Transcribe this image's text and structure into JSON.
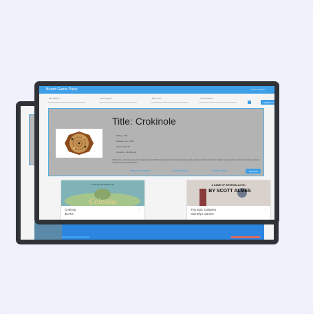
{
  "app": {
    "title": "Board Game Party",
    "user": "Hello Jonathan"
  },
  "filters": {
    "fields": [
      "Min Players",
      "Max Players",
      "Max Time",
      "Name Search"
    ],
    "search_label": "SEARCH",
    "search_icon": "search-icon"
  },
  "detail": {
    "title": "Title: Crokinole",
    "facts": [
      "Rating: 6.95",
      "Release Year: 1876",
      "Value: $144.95",
      "Condition: Unaffected"
    ],
    "description": "Crokinole is a dexterity game where players take turns flicking discs across the circular playing surface, trying to land their discs in the higher scoring regions of the board, while also trying to knock away opponent's discs.",
    "links": [
      "Search on Amazon",
      "Youtube Video",
      "Youtube Video"
    ],
    "sell_label": "Sell Game"
  },
  "cards": [
    {
      "name": "Celestia",
      "sub": "$LAM !",
      "art_text": "Celestia",
      "art_top": "AARON WEISSBLUM"
    },
    {
      "name": "Tiny Epic Galaxies",
      "sub": "Gamelyn Games",
      "art_text": "BY SCOTT ALMES",
      "art_top": "A GAME OF INTERGALACTIC"
    }
  ],
  "colors": {
    "accent": "#3d9fe8",
    "monitor": "#2f3338",
    "overlay": "#b3b3b3"
  }
}
